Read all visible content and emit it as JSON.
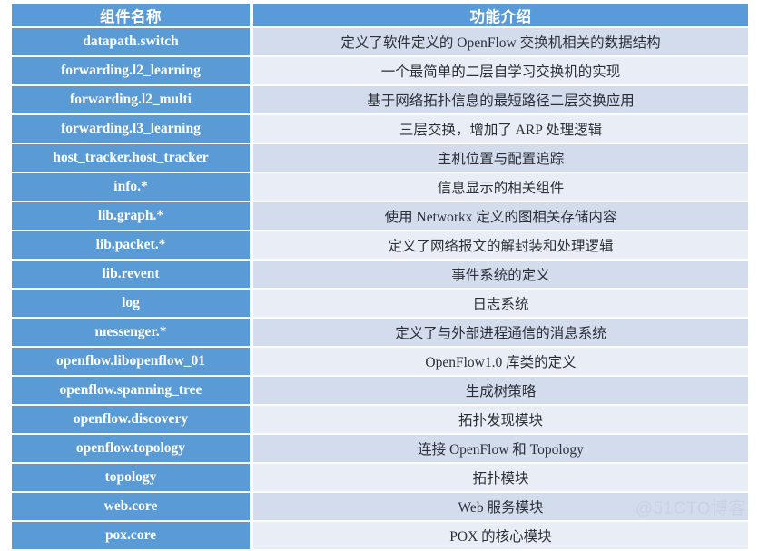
{
  "table": {
    "headers": {
      "component": "组件名称",
      "description": "功能介绍"
    },
    "rows": [
      {
        "component": "datapath.switch",
        "description": "定义了软件定义的 OpenFlow 交换机相关的数据结构"
      },
      {
        "component": "forwarding.l2_learning",
        "description": "一个最简单的二层自学习交换机的实现"
      },
      {
        "component": "forwarding.l2_multi",
        "description": "基于网络拓扑信息的最短路径二层交换应用"
      },
      {
        "component": "forwarding.l3_learning",
        "description": "三层交换，增加了 ARP 处理逻辑"
      },
      {
        "component": "host_tracker.host_tracker",
        "description": "主机位置与配置追踪"
      },
      {
        "component": "info.*",
        "description": "信息显示的相关组件"
      },
      {
        "component": "lib.graph.*",
        "description": "使用 Networkx 定义的图相关存储内容"
      },
      {
        "component": "lib.packet.*",
        "description": "定义了网络报文的解封装和处理逻辑"
      },
      {
        "component": "lib.revent",
        "description": "事件系统的定义"
      },
      {
        "component": "log",
        "description": "日志系统"
      },
      {
        "component": "messenger.*",
        "description": "定义了与外部进程通信的消息系统"
      },
      {
        "component": "openflow.libopenflow_01",
        "description": "OpenFlow1.0 库类的定义"
      },
      {
        "component": "openflow.spanning_tree",
        "description": "生成树策略"
      },
      {
        "component": "openflow.discovery",
        "description": "拓扑发现模块"
      },
      {
        "component": "openflow.topology",
        "description": "连接 OpenFlow 和 Topology"
      },
      {
        "component": "topology",
        "description": "拓扑模块"
      },
      {
        "component": "web.core",
        "description": "Web 服务模块"
      },
      {
        "component": "pox.core",
        "description": "POX 的核心模块"
      }
    ]
  },
  "watermark": {
    "text": "@51CTO博客"
  },
  "colors": {
    "header_blue": "#599bd8",
    "name_blue": "#5b9bd5",
    "row_even": "#d3dcec",
    "row_odd": "#e9edf6",
    "text_dark": "#2b2f38",
    "text_light": "#ffffff",
    "watermark": "#c9d2e3"
  }
}
